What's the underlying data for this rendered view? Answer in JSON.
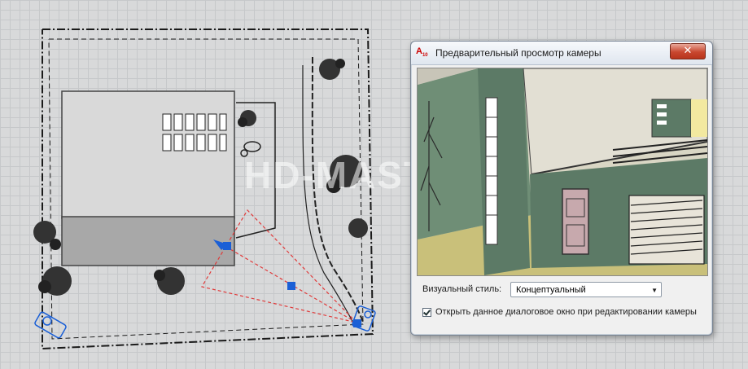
{
  "watermark": "HD-MASTER",
  "dialog": {
    "title": "Предварительный просмотр камеры",
    "app_icon": "A",
    "app_icon_sub": "10",
    "close_symbol": "✕",
    "visual_style_label": "Визуальный стиль:",
    "visual_style_value": "Концептуальный",
    "dropdown_arrow": "▼",
    "reopen_checkbox_label": "Открыть данное диалоговое окно при редактировании камеры",
    "reopen_checked": true
  },
  "colors": {
    "camera_blue": "#1a5fd6",
    "frustum_red": "#e03a3a",
    "wall_green": "#5c7a66",
    "floor_yellow": "#c9c07a"
  }
}
